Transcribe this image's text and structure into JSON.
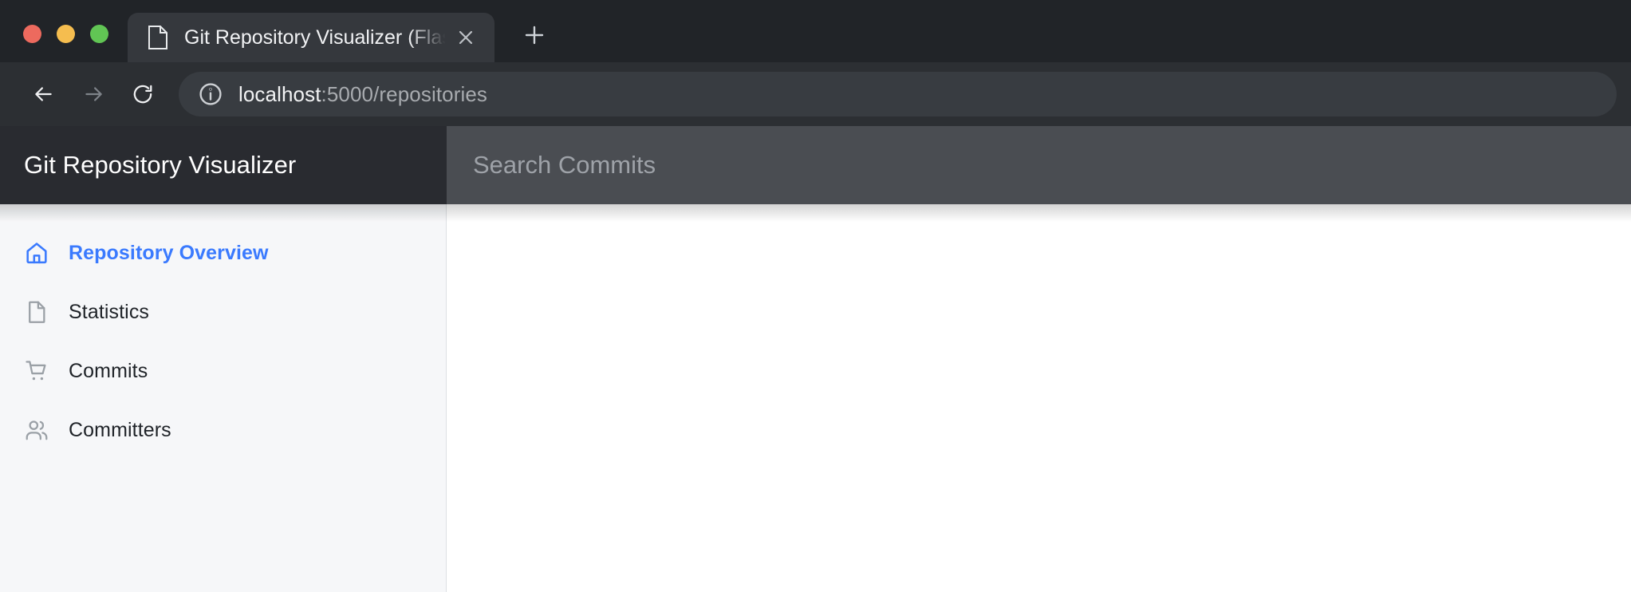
{
  "browser": {
    "window_controls": [
      {
        "name": "close",
        "color": "#ed6a5e"
      },
      {
        "name": "minimize",
        "color": "#f5bd4f"
      },
      {
        "name": "maximize",
        "color": "#61c554"
      }
    ],
    "tab": {
      "title": "Git Repository Visualizer (Flask",
      "favicon": "page-icon",
      "close_label": "×"
    },
    "new_tab_label": "+",
    "nav": {
      "back": "←",
      "forward": "→",
      "reload": "⟳"
    },
    "address": {
      "security_icon": "info-circle-icon",
      "host": "localhost",
      "path": ":5000/repositories",
      "full": "localhost:5000/repositories"
    }
  },
  "app": {
    "title": "Git Repository Visualizer",
    "search": {
      "placeholder": "Search Commits",
      "value": ""
    },
    "accent_color": "#3a7afe",
    "sidebar": {
      "items": [
        {
          "label": "Repository Overview",
          "icon": "home-icon",
          "active": true
        },
        {
          "label": "Statistics",
          "icon": "document-icon",
          "active": false
        },
        {
          "label": "Commits",
          "icon": "cart-icon",
          "active": false
        },
        {
          "label": "Committers",
          "icon": "users-icon",
          "active": false
        }
      ]
    },
    "content": {
      "body_text": ""
    }
  }
}
